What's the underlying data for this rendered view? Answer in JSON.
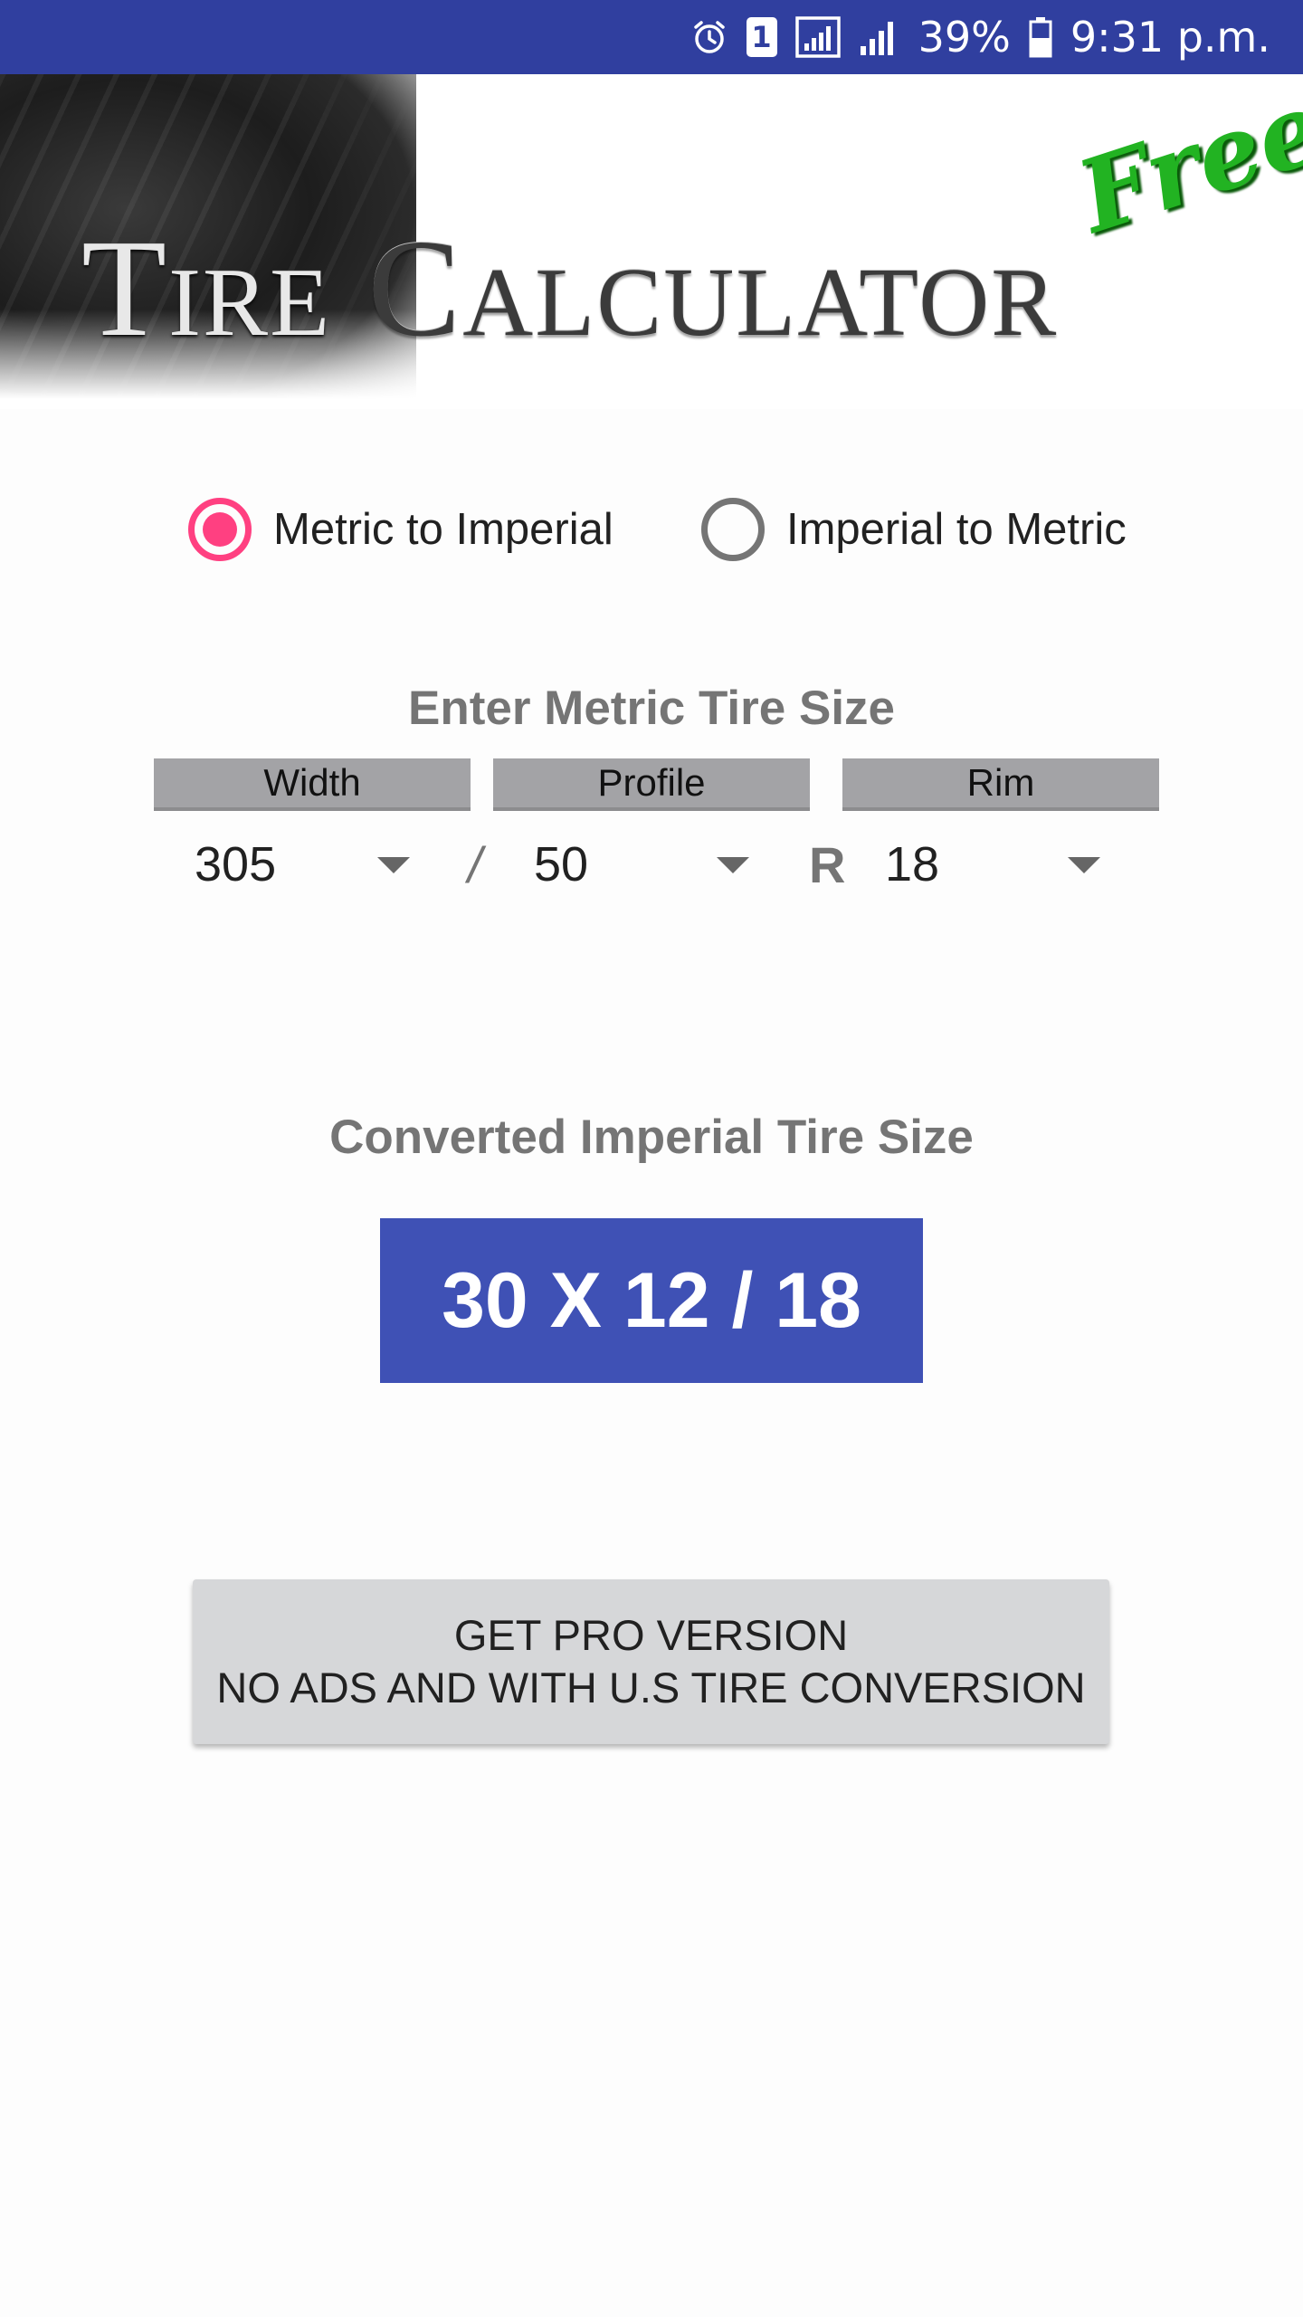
{
  "status_bar": {
    "battery_percent": "39%",
    "time": "9:31 p.m.",
    "sim_slot": "1",
    "icons": [
      "alarm-icon",
      "sim-icon",
      "signal-icon",
      "signal-bars-icon",
      "battery-icon"
    ]
  },
  "banner": {
    "title_part1": "Tire",
    "title_part2": "Calculator",
    "badge": "Free"
  },
  "conversion_mode": {
    "options": [
      {
        "label": "Metric to Imperial",
        "selected": true
      },
      {
        "label": "Imperial to Metric",
        "selected": false
      }
    ]
  },
  "input_section": {
    "heading": "Enter Metric Tire Size",
    "columns": [
      "Width",
      "Profile",
      "Rim"
    ],
    "width_value": "305",
    "profile_value": "50",
    "rim_value": "18",
    "separator_slash": "/",
    "separator_r": "R"
  },
  "result_section": {
    "heading": "Converted Imperial Tire Size",
    "value": "30 X 12 / 18"
  },
  "pro_button": {
    "line1": "GET PRO VERSION",
    "line2": "NO ADS AND WITH U.S TIRE CONVERSION"
  },
  "colors": {
    "status_bar": "#303f9f",
    "accent": "#ff4081",
    "result_bg": "#3f51b5",
    "header_gray": "#a3a3a6",
    "button_gray": "#d6d7d9",
    "heading_text": "#757575",
    "badge_green": "#22b322"
  }
}
